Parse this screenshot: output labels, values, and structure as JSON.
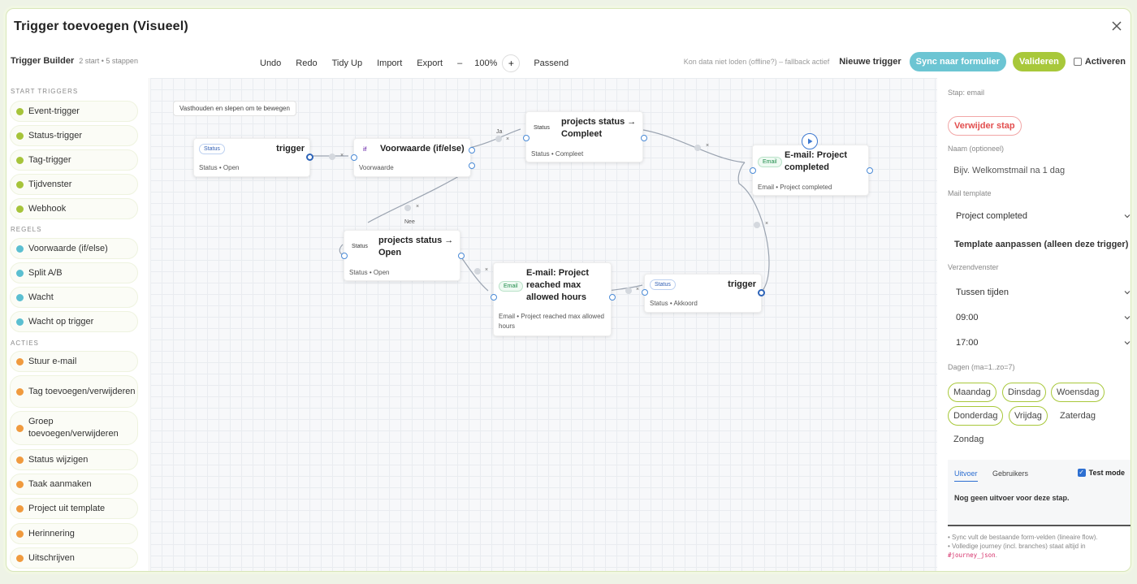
{
  "modal": {
    "title": "Trigger toevoegen (Visueel)"
  },
  "toolbar": {
    "title": "Trigger Builder",
    "meta": "2 start • 5 stappen",
    "undo": "Undo",
    "redo": "Redo",
    "tidy": "Tidy Up",
    "import": "Import",
    "export": "Export",
    "zoom_minus": "–",
    "zoom": "100%",
    "zoom_plus": "+",
    "fit": "Passend",
    "offline_note": "Kon data niet loden (offline?) – fallback actief",
    "new_trigger": "Nieuwe trigger",
    "sync": "Sync naar formulier",
    "validate": "Valideren",
    "activate": "Activeren",
    "colors": {
      "sync": "#6cc5d3",
      "validate": "#a8c83a"
    }
  },
  "sidebar": {
    "sections": [
      {
        "label": "START TRIGGERS",
        "color": "#a6c43a",
        "items": [
          "Event-trigger",
          "Status-trigger",
          "Tag-trigger",
          "Tijdvenster",
          "Webhook"
        ]
      },
      {
        "label": "REGELS",
        "color": "#5bbfd1",
        "items": [
          "Voorwaarde (if/else)",
          "Split A/B",
          "Wacht",
          "Wacht op trigger"
        ]
      },
      {
        "label": "ACTIES",
        "color": "#f09a3e",
        "items": [
          "Stuur e-mail",
          "Tag toevoegen/verwijderen",
          "Groep toevoegen/verwijderen",
          "Status wijzigen",
          "Taak aanmaken",
          "Project uit template",
          "Herinnering",
          "Uitschrijven"
        ]
      }
    ]
  },
  "canvas": {
    "hint": "Vasthouden en slepen om te bewegen",
    "nodes": {
      "trigger1": {
        "badge": "Status",
        "title": "trigger",
        "sub": "Status • Open"
      },
      "cond": {
        "badge": "if",
        "title": "Voorwaarde (if/else)",
        "sub": "Voorwaarde"
      },
      "compleet": {
        "badge": "Status",
        "title": "projects status → Compleet",
        "sub": "Status • Compleet"
      },
      "emailCompleted": {
        "badge": "Email",
        "title": "E-mail: Project completed",
        "sub": "Email • Project completed"
      },
      "open": {
        "badge": "Status",
        "title": "projects status → Open",
        "sub": "Status • Open"
      },
      "emailMax": {
        "badge": "Email",
        "title": "E-mail: Project reached max allowed hours",
        "sub": "Email • Project reached max allowed hours"
      },
      "trigger2": {
        "badge": "Status",
        "title": "trigger",
        "sub": "Status • Akkoord"
      }
    },
    "edge_labels": {
      "yes": "Ja",
      "no": "Nee",
      "remove": "×"
    }
  },
  "panel": {
    "step_label": "Stap: email",
    "delete": "Verwijder stap",
    "name_label": "Naam (optioneel)",
    "name_placeholder": "Bijv. Welkomstmail na 1 dag",
    "template_label": "Mail template",
    "template_value": "Project completed",
    "template_edit": "Template aanpassen (alleen deze trigger)",
    "window_label": "Verzendvenster",
    "window_value": "Tussen tijden",
    "time_from": "09:00",
    "time_to": "17:00",
    "days_label": "Dagen (ma=1..zo=7)",
    "days": [
      {
        "label": "Maandag",
        "on": true
      },
      {
        "label": "Dinsdag",
        "on": true
      },
      {
        "label": "Woensdag",
        "on": true
      },
      {
        "label": "Donderdag",
        "on": true
      },
      {
        "label": "Vrijdag",
        "on": true
      },
      {
        "label": "Zaterdag",
        "on": false
      },
      {
        "label": "Zondag",
        "on": false
      }
    ],
    "tab_output": "Uitvoer",
    "tab_users": "Gebruikers",
    "test_mode": "Test mode",
    "no_output": "Nog geen uitvoer voor deze stap.",
    "note1": "• Sync vult de bestaande form-velden (lineaire flow).",
    "note2": "• Volledige journey (incl. branches) staat altijd in",
    "note_code": "#journey_json",
    "note_end": "."
  }
}
